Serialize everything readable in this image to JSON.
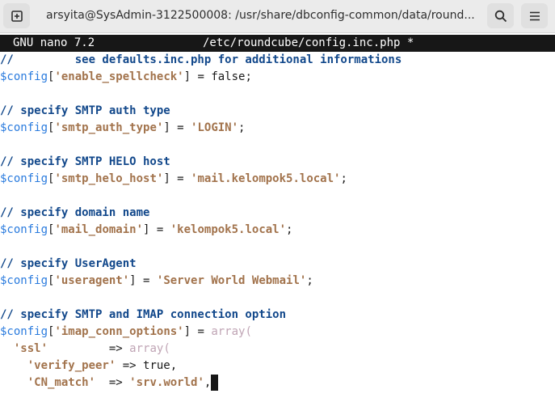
{
  "window": {
    "title": "arsyita@SysAdmin-3122500008: /usr/share/dbconfig-common/data/round...",
    "new_tab_icon": "new-tab-icon",
    "search_icon": "search-icon",
    "menu_icon": "hamburger-menu-icon"
  },
  "nano": {
    "app": "GNU nano 7.2",
    "file": "/etc/roundcube/config.inc.php *"
  },
  "code": [
    {
      "comment": "//         see defaults.inc.php for additional informations"
    },
    {
      "var": "$config",
      "p1": "[",
      "key": "'enable_spellcheck'",
      "p2": "] = false;"
    },
    {},
    {
      "comment": "// specify SMTP auth type"
    },
    {
      "var": "$config",
      "p1": "[",
      "key": "'smtp_auth_type'",
      "p2": "] = ",
      "val": "'LOGIN'",
      "p3": ";"
    },
    {},
    {
      "comment": "// specify SMTP HELO host"
    },
    {
      "var": "$config",
      "p1": "[",
      "key": "'smtp_helo_host'",
      "p2": "] = ",
      "val": "'mail.kelompok5.local'",
      "p3": ";"
    },
    {},
    {
      "comment": "// specify domain name"
    },
    {
      "var": "$config",
      "p1": "[",
      "key": "'mail_domain'",
      "p2": "] = ",
      "val": "'kelompok5.local'",
      "p3": ";"
    },
    {},
    {
      "comment": "// specify UserAgent"
    },
    {
      "var": "$config",
      "p1": "[",
      "key": "'useragent'",
      "p2": "] = ",
      "val": "'Server World Webmail'",
      "p3": ";"
    },
    {},
    {
      "comment": "// specify SMTP and IMAP connection option"
    },
    {
      "var": "$config",
      "p1": "[",
      "key": "'imap_conn_options'",
      "p2": "] = ",
      "fn": "array("
    },
    {
      "indent": "  ",
      "key": "'ssl'",
      "p2": "         => ",
      "fn": "array("
    },
    {
      "indent": "    ",
      "key": "'verify_peer'",
      "p2": " => true,"
    },
    {
      "indent": "    ",
      "key": "'CN_match'",
      "p2": "  => ",
      "val": "'srv.world'",
      "p3": ","
    }
  ]
}
